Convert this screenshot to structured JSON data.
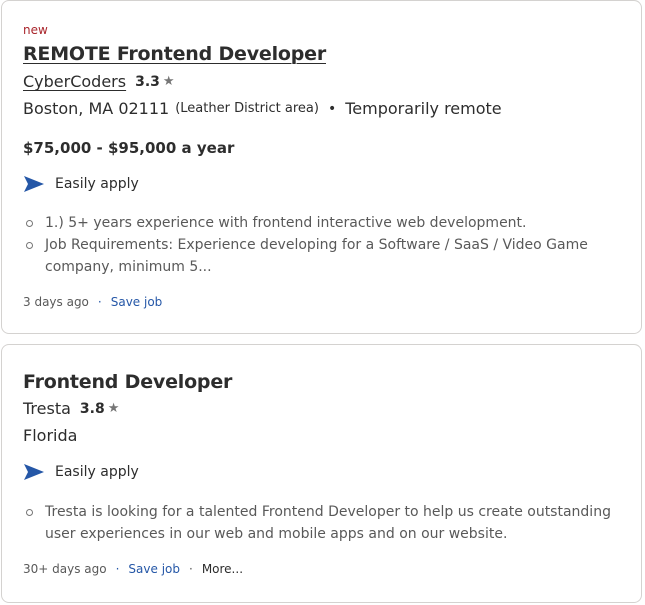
{
  "jobs": [
    {
      "badge": "new",
      "title": "REMOTE Frontend Developer",
      "company": "CyberCoders",
      "rating": "3.3",
      "location": "Boston, MA 02111",
      "area": "(Leather District area)",
      "separator": "•",
      "remote": "Temporarily remote",
      "salary": "$75,000 - $95,000 a year",
      "apply_label": "Easily apply",
      "snippet": [
        "1.) 5+ years experience with frontend interactive web development.",
        "Job Requirements: Experience developing for a Software / SaaS / Video Game company, minimum 5..."
      ],
      "posted": "3 days ago",
      "save_label": "Save job"
    },
    {
      "title": "Frontend Developer",
      "company": "Tresta",
      "rating": "3.8",
      "location": "Florida",
      "apply_label": "Easily apply",
      "snippet": [
        "Tresta is looking for a talented Frontend Developer to help us create outstanding user experiences in our web and mobile apps and on our website."
      ],
      "posted": "30+ days ago",
      "save_label": "Save job",
      "more_label": "More..."
    }
  ],
  "icons": {
    "rating": "star-icon",
    "apply": "send-arrow-icon"
  },
  "colors": {
    "new_badge": "#a9252b",
    "link_blue": "#2557a7",
    "text": "#2d2d2d",
    "muted": "#595959",
    "card_border": "#d4d2d0"
  }
}
